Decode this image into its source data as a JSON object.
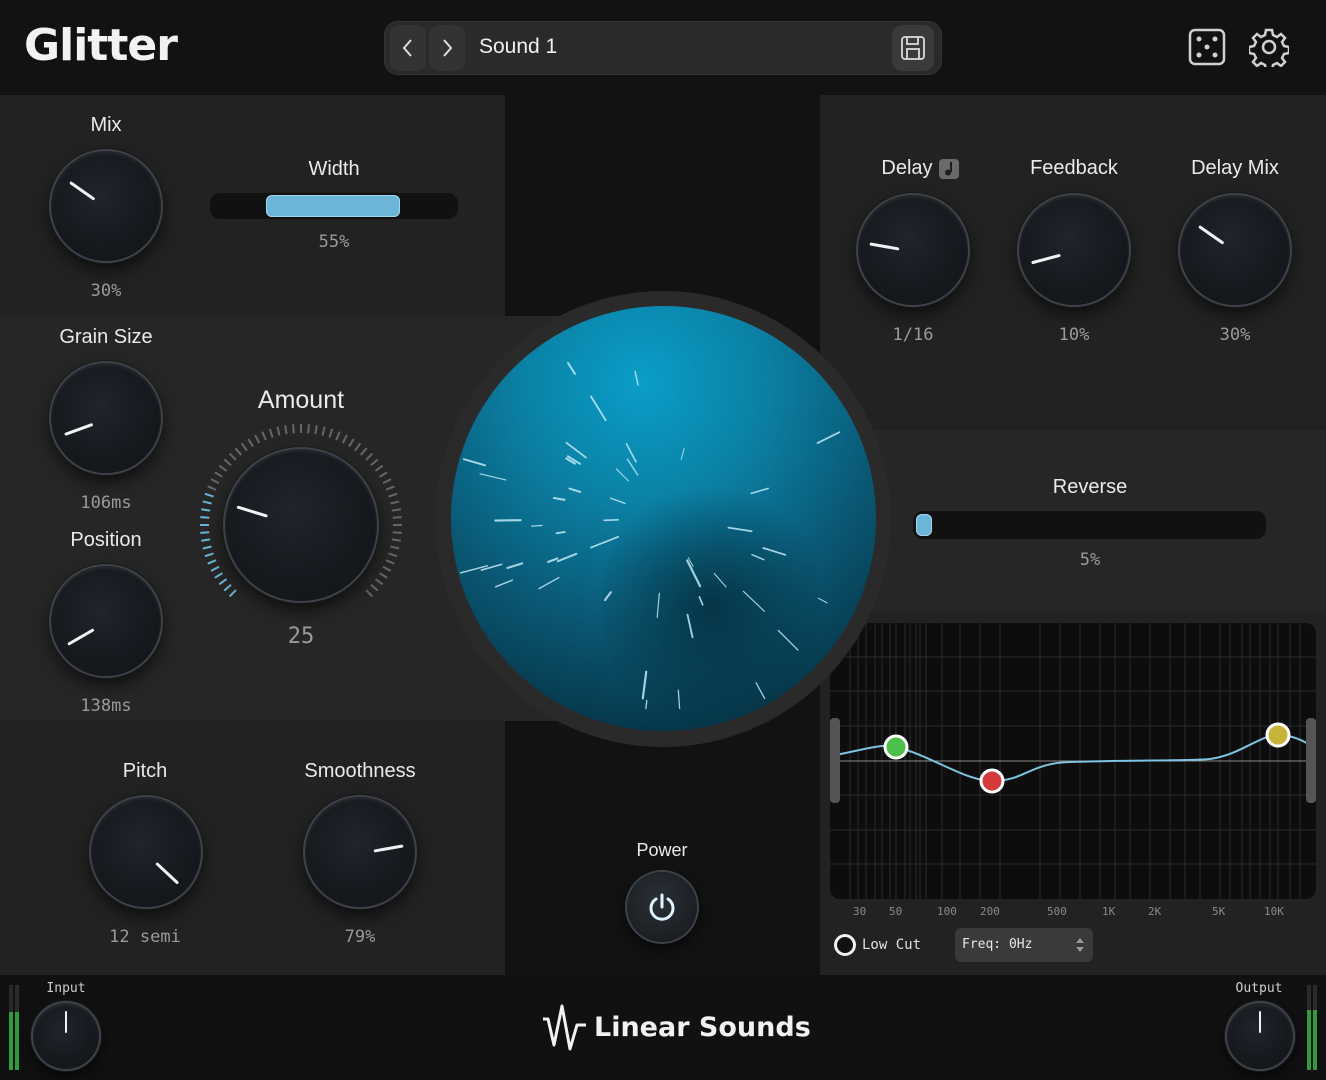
{
  "app": {
    "title": "Glitter"
  },
  "preset": {
    "name": "Sound 1"
  },
  "icons": {
    "prev": "chevron-left-icon",
    "next": "chevron-right-icon",
    "save": "save-icon",
    "random": "dice-icon",
    "settings": "gear-icon",
    "power": "power-icon",
    "note": "music-note-icon"
  },
  "controls": {
    "mix": {
      "label": "Mix",
      "value": "30%"
    },
    "width": {
      "label": "Width",
      "value": "55%",
      "level": 0.55
    },
    "grain_size": {
      "label": "Grain Size",
      "value": "106ms"
    },
    "position": {
      "label": "Position",
      "value": "138ms"
    },
    "amount": {
      "label": "Amount",
      "value": "25"
    },
    "pitch": {
      "label": "Pitch",
      "value": "12 semi"
    },
    "smoothness": {
      "label": "Smoothness",
      "value": "79%"
    },
    "delay": {
      "label": "Delay",
      "value": "1/16"
    },
    "feedback": {
      "label": "Feedback",
      "value": "10%"
    },
    "delay_mix": {
      "label": "Delay Mix",
      "value": "30%"
    },
    "reverse": {
      "label": "Reverse",
      "value": "5%",
      "level": 0.05
    },
    "power": {
      "label": "Power"
    },
    "input": {
      "label": "Input"
    },
    "output": {
      "label": "Output"
    }
  },
  "eq": {
    "freq_labels": [
      "30",
      "50",
      "100",
      "200",
      "500",
      "1K",
      "2K",
      "5K",
      "10K"
    ],
    "band_type": "Low Cut",
    "freq_field": "Freq: 0Hz",
    "colors": {
      "band1": "#4cc04a",
      "band2": "#d43a3a",
      "band3": "#c9b43a",
      "curve": "#7ec3e2"
    }
  },
  "footer": {
    "brand": "Linear Sounds"
  },
  "colors": {
    "accent": "#6bb5d8",
    "background": "#121212",
    "panel": "#222222"
  }
}
